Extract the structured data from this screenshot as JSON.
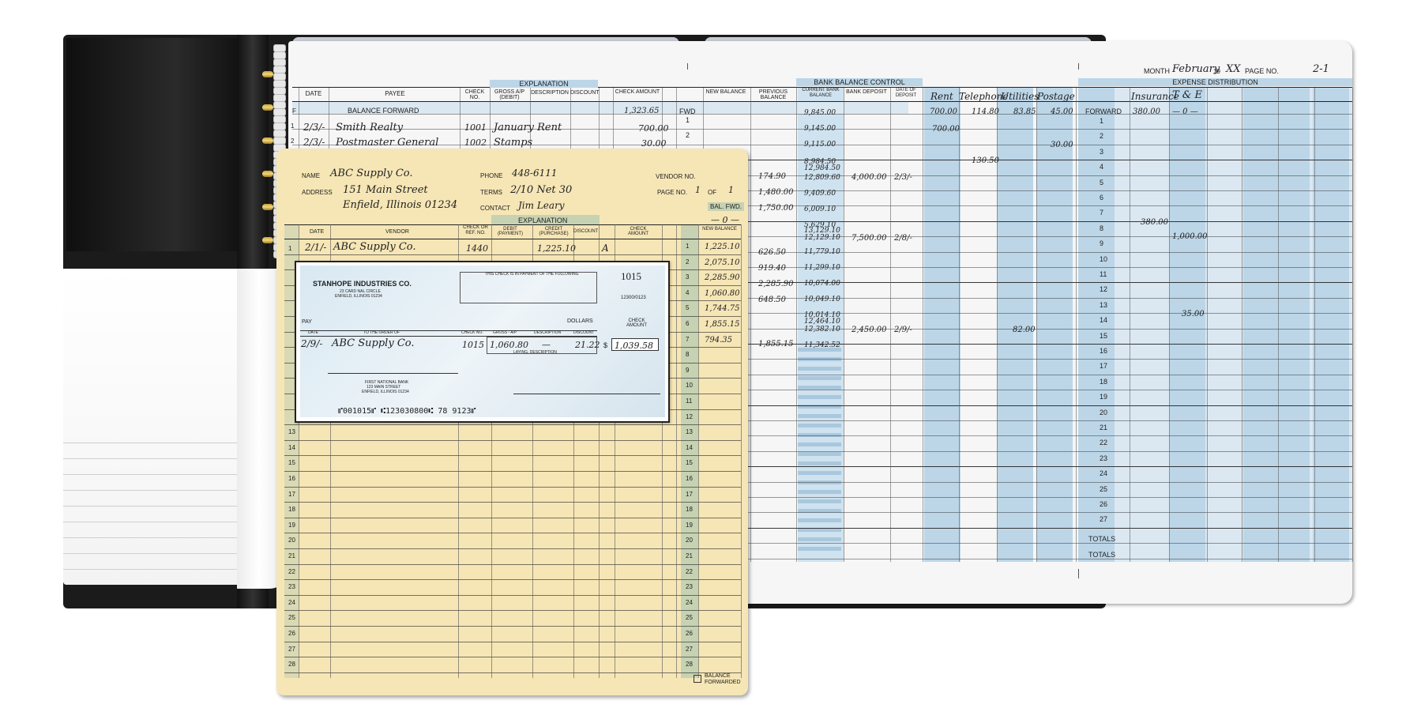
{
  "ledger": {
    "month_label": "MONTH",
    "month_value": "February",
    "year_prefix": "19",
    "year_value": "XX",
    "page_label": "PAGE NO.",
    "page_value": "2-1",
    "explanation_header": "EXPLANATION",
    "bank_balance_control": "BANK BALANCE CONTROL",
    "expense_distribution": "EXPENSE DISTRIBUTION",
    "columns": {
      "date": "DATE",
      "payee": "PAYEE",
      "check_no": "CHECK NO.",
      "gross_ap": "GROSS A/P (DEBIT)",
      "description": "DESCRIPTION",
      "discount": "DISCOUNT",
      "check_amount": "CHECK AMOUNT",
      "new_balance": "NEW BALANCE",
      "previous_balance": "PREVIOUS BALANCE",
      "current_bank_balance": "CURRENT BANK BALANCE",
      "bank_deposit": "BANK DEPOSIT",
      "date_of_deposit": "DATE OF DEPOSIT"
    },
    "expense_cols": [
      "Rent",
      "Telephone",
      "Utilities",
      "Postage",
      "",
      "Insurance",
      "T & E"
    ],
    "balance_forward": "BALANCE FORWARD",
    "balance_forward_amount": "1,323.65",
    "fwd": "FWD",
    "forward_label": "FORWARD",
    "totals": [
      "TOTALS",
      "TOTALS"
    ],
    "row_f": "F",
    "entries": [
      {
        "num": "1",
        "date": "2/3/-",
        "payee": "Smith Realty",
        "check": "1001",
        "desc": "January Rent",
        "amount": "700.00"
      },
      {
        "num": "2",
        "date": "2/3/-",
        "payee": "Postmaster General",
        "check": "1002",
        "desc": "Stamps",
        "amount": "30.00"
      }
    ],
    "bank_balances": [
      "9,845.00",
      "9,145.00",
      "9,115.00",
      "8,984.50",
      "12,984.50",
      "12,809.60",
      "9,409.60",
      "6,009.10",
      "5,629.10",
      "13,129.10",
      "12,129.10",
      "11,779.10",
      "11,299.10",
      "10,074.00",
      "10,049.10",
      "10,014.10",
      "12,464.10",
      "12,382.10",
      "11,342.52"
    ],
    "deposits": [
      {
        "amount": "4,000.00",
        "date": "2/3/-"
      },
      {
        "amount": "7,500.00",
        "date": "2/8/-"
      },
      {
        "amount": "2,450.00",
        "date": "2/9/-"
      }
    ],
    "prev_balances": [
      "174.90",
      "1,480.00",
      "1,750.00",
      "626.50",
      "919.40",
      "2,285.90",
      "648.50",
      "1,855.15"
    ],
    "forward_amounts": {
      "rent": "700.00",
      "telephone": "114.80",
      "utilities": "83.85",
      "postage": "45.00",
      "insurance": "380.00",
      "te": "— 0 —"
    },
    "expense_entries": {
      "rent_1": "700.00",
      "postage_2": "30.00",
      "telephone_3": "130.50",
      "insurance_7": "380.00",
      "te_8": "1,000.00",
      "te_13": "35.00",
      "utilities_14": "82.00"
    },
    "row_numbers": [
      "1",
      "2",
      "3",
      "4",
      "5",
      "6",
      "7",
      "8",
      "9",
      "10",
      "11",
      "12",
      "13",
      "14",
      "15",
      "16",
      "17",
      "18",
      "19",
      "20",
      "21",
      "22",
      "23",
      "24",
      "25",
      "26",
      "27"
    ]
  },
  "card": {
    "name_label": "NAME",
    "name_value": "ABC Supply Co.",
    "address_label": "ADDRESS",
    "address_line1": "151 Main Street",
    "address_line2": "Enfield, Illinois 01234",
    "phone_label": "PHONE",
    "phone_value": "448-6111",
    "terms_label": "TERMS",
    "terms_value": "2/10 Net 30",
    "contact_label": "CONTACT",
    "contact_value": "Jim Leary",
    "vendor_no_label": "VENDOR NO.",
    "page_no_label": "PAGE NO.",
    "page_no_value": "1",
    "of_label": "OF",
    "of_value": "1",
    "bal_fwd": "BAL. FWD.",
    "bal_fwd_value": "— 0 —",
    "explanation": "EXPLANATION",
    "cols": {
      "date": "DATE",
      "vendor": "VENDOR",
      "check_ref": "CHECK OR REF. NO.",
      "debit": "DEBIT (PAYMENT)",
      "credit": "CREDIT (PURCHASE)",
      "discount": "DISCOUNT",
      "check_amount": "CHECK AMOUNT",
      "new_balance": "NEW BALANCE"
    },
    "entry": {
      "num": "1",
      "date": "2/1/-",
      "vendor": "ABC Supply Co.",
      "ref": "1440",
      "credit": "1,225.10",
      "mark": "A"
    },
    "new_balances": [
      "1,225.10",
      "2,075.10",
      "2,285.90",
      "1,060.80",
      "1,744.75",
      "1,855.15",
      "794.35"
    ],
    "row_numbers": [
      "1",
      "2",
      "3",
      "4",
      "5",
      "6",
      "7",
      "8",
      "9",
      "10",
      "11",
      "12",
      "13",
      "14",
      "15",
      "16",
      "17",
      "18",
      "19",
      "20",
      "21",
      "22",
      "23",
      "24",
      "25",
      "26",
      "27",
      "28"
    ],
    "balance_forwarded": "BALANCE FORWARDED"
  },
  "check": {
    "company": "STANHOPE INDUSTRIES CO.",
    "company_addr1": "23 CARD NAL CIRCLE",
    "company_addr2": "ENFIELD, ILLINOIS 01234",
    "payment_note": "THIS CHECK IS IN PAYMENT OF THE FOLLOWING",
    "number": "1015",
    "routing_small": "12300/0123",
    "pay": "PAY",
    "dollars": "DOLLARS",
    "check_amount_label": "CHECK AMOUNT",
    "cols": {
      "date": "DATE",
      "to_order": "TO THE ORDER OF",
      "check_no": "CHECK NO.",
      "gross": "GROSS - A/P",
      "description": "DESCRIPTION",
      "discount": "DISCOUNT"
    },
    "date": "2/9/-",
    "payee": "ABC Supply Co.",
    "check_no": "1015",
    "gross": "1,060.80",
    "desc": "—",
    "discount": "21.22",
    "dollar_sign": "$",
    "amount": "1,039.58",
    "remittance": "LAYING, DESCRIPTION",
    "bank1": "FIRST NATIONAL BANK",
    "bank2": "123 MAIN STREET",
    "bank3": "ENFIELD, ILLINOIS 01234",
    "micr": "⑈001015⑈ ⑆123030800⑆ 78 9123⑈"
  }
}
